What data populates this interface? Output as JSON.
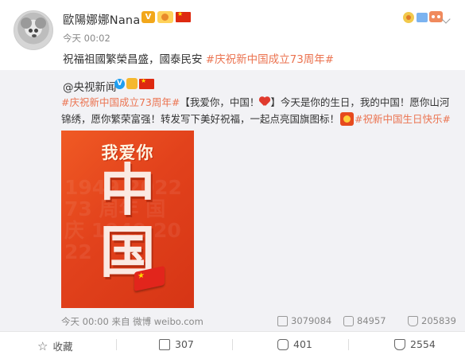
{
  "post": {
    "author": "歐陽娜娜Nana",
    "vip_badge": "V",
    "time": "今天 00:02",
    "text_plain": "祝福祖國繁榮昌盛，國泰民安",
    "hashtag": "#庆祝新中国成立73周年#"
  },
  "repost": {
    "author": "@央视新闻",
    "verified_badge": "V",
    "text_hashtag1": "#庆祝新中国成立73周年#",
    "text_part1": "【我爱你，中国！",
    "text_part2": "】今天是你的生日，我的中国！愿你山河锦绣，愿你繁荣富强！转发写下美好祝福，一起点亮国旗图标！",
    "text_hashtag2": "#祝新中国生日快乐#",
    "image": {
      "title": "我爱你",
      "char1": "中",
      "char2": "国",
      "background_text": "1949 2022 73 周年 国 庆 1949 2022"
    },
    "meta": "今天 00:00 来自 微博 weibo.com",
    "reposts": "3079084",
    "comments": "84957",
    "likes": "205839"
  },
  "actions": {
    "favorite": "收藏",
    "forward": "307",
    "comment": "401",
    "like": "2554"
  },
  "colors": {
    "hashtag": "#eb7350",
    "background_repost": "#f2f2f5",
    "poster_red": "#e2421c"
  }
}
